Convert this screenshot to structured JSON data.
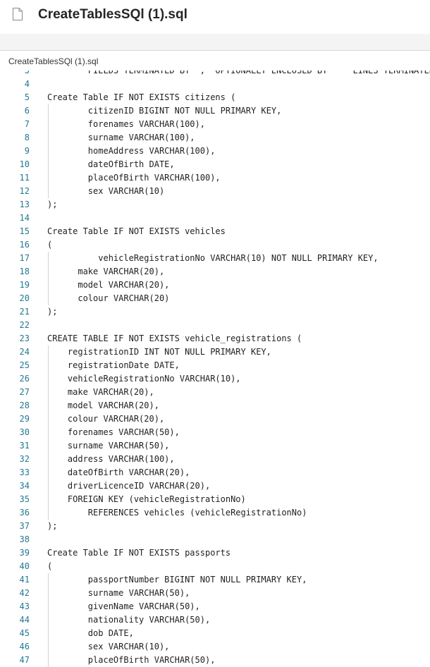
{
  "window": {
    "title": "CreateTablesSQl (1).sql",
    "icon": "file-icon"
  },
  "editor": {
    "tab_label": "CreateTablesSQl (1).sql",
    "partial_line": {
      "number": "3",
      "text": "        FIELDS TERMINATED BY ',' OPTIONALLY ENCLOSED BY '\"' LINES TERMINATED BY"
    },
    "lines": [
      {
        "n": "4",
        "text": ""
      },
      {
        "n": "5",
        "text": "Create Table IF NOT EXISTS citizens ("
      },
      {
        "n": "6",
        "text": "        citizenID BIGINT NOT NULL PRIMARY KEY,"
      },
      {
        "n": "7",
        "text": "        forenames VARCHAR(100),"
      },
      {
        "n": "8",
        "text": "        surname VARCHAR(100),"
      },
      {
        "n": "9",
        "text": "        homeAddress VARCHAR(100),"
      },
      {
        "n": "10",
        "text": "        dateOfBirth DATE,"
      },
      {
        "n": "11",
        "text": "        placeOfBirth VARCHAR(100),"
      },
      {
        "n": "12",
        "text": "        sex VARCHAR(10)"
      },
      {
        "n": "13",
        "text": ");"
      },
      {
        "n": "14",
        "text": ""
      },
      {
        "n": "15",
        "text": "Create Table IF NOT EXISTS vehicles"
      },
      {
        "n": "16",
        "text": "("
      },
      {
        "n": "17",
        "text": "          vehicleRegistrationNo VARCHAR(10) NOT NULL PRIMARY KEY,"
      },
      {
        "n": "18",
        "text": "      make VARCHAR(20),"
      },
      {
        "n": "19",
        "text": "      model VARCHAR(20),"
      },
      {
        "n": "20",
        "text": "      colour VARCHAR(20)"
      },
      {
        "n": "21",
        "text": ");"
      },
      {
        "n": "22",
        "text": ""
      },
      {
        "n": "23",
        "text": "CREATE TABLE IF NOT EXISTS vehicle_registrations ("
      },
      {
        "n": "24",
        "text": "    registrationID INT NOT NULL PRIMARY KEY,"
      },
      {
        "n": "25",
        "text": "    registrationDate DATE,"
      },
      {
        "n": "26",
        "text": "    vehicleRegistrationNo VARCHAR(10),"
      },
      {
        "n": "27",
        "text": "    make VARCHAR(20),"
      },
      {
        "n": "28",
        "text": "    model VARCHAR(20),"
      },
      {
        "n": "29",
        "text": "    colour VARCHAR(20),"
      },
      {
        "n": "30",
        "text": "    forenames VARCHAR(50),"
      },
      {
        "n": "31",
        "text": "    surname VARCHAR(50),"
      },
      {
        "n": "32",
        "text": "    address VARCHAR(100),"
      },
      {
        "n": "33",
        "text": "    dateOfBirth VARCHAR(20),"
      },
      {
        "n": "34",
        "text": "    driverLicenceID VARCHAR(20),"
      },
      {
        "n": "35",
        "text": "    FOREIGN KEY (vehicleRegistrationNo)"
      },
      {
        "n": "36",
        "text": "        REFERENCES vehicles (vehicleRegistrationNo)"
      },
      {
        "n": "37",
        "text": ");"
      },
      {
        "n": "38",
        "text": ""
      },
      {
        "n": "39",
        "text": "Create Table IF NOT EXISTS passports"
      },
      {
        "n": "40",
        "text": "("
      },
      {
        "n": "41",
        "text": "        passportNumber BIGINT NOT NULL PRIMARY KEY,"
      },
      {
        "n": "42",
        "text": "        surname VARCHAR(50),"
      },
      {
        "n": "43",
        "text": "        givenName VARCHAR(50),"
      },
      {
        "n": "44",
        "text": "        nationality VARCHAR(50),"
      },
      {
        "n": "45",
        "text": "        dob DATE,"
      },
      {
        "n": "46",
        "text": "        sex VARCHAR(10),"
      },
      {
        "n": "47",
        "text": "        placeOfBirth VARCHAR(50),"
      }
    ]
  },
  "colors": {
    "line_number": "#237893",
    "code_text": "#1f1f1f",
    "indent_guide": "#d3d3d3",
    "gap_background": "#f4f4f4"
  }
}
